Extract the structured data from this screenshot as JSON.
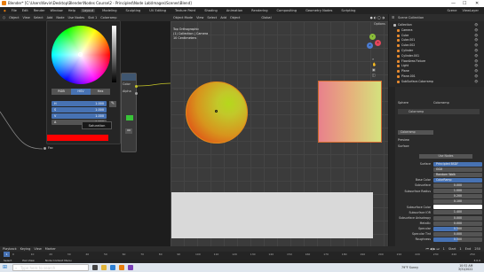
{
  "titlebar": {
    "title": "Blender* [C:\\Users\\Kevin\\Desktop\\Blender\\Nodes Course\\2 - Principled\\Node Lab\\Images\\Scenes\\Blend]",
    "min": "—",
    "max": "☐",
    "close": "✕"
  },
  "menubar": {
    "menus": [
      "File",
      "Edit",
      "Render",
      "Window",
      "Help"
    ],
    "workspaces": [
      "Layout",
      "Modeling",
      "Sculpting",
      "UV Editing",
      "Texture Paint",
      "Shading",
      "Animation",
      "Rendering",
      "Compositing",
      "Geometry Nodes",
      "Scripting"
    ],
    "active_workspace": "Layout",
    "scene": "Scene",
    "view_layer": "ViewLayer"
  },
  "node_editor": {
    "header": [
      "Object",
      "View",
      "Select",
      "Add",
      "Node",
      "Use Nodes",
      "Slot 1",
      "Colorramp"
    ],
    "socket_fac": "Fac",
    "socket_color": "Color",
    "socket_alpha": "Alpha"
  },
  "color_picker": {
    "tabs": [
      "RGB",
      "HSV",
      "Hex"
    ],
    "active_tab": "HSV",
    "fields": [
      {
        "label": "H",
        "value": "1.000"
      },
      {
        "label": "S",
        "value": "1.000"
      },
      {
        "label": "V",
        "value": "1.000"
      },
      {
        "label": "A",
        "value": "1.000"
      }
    ],
    "tooltip": "Saturation",
    "swatch_color": "#ff0000"
  },
  "viewport": {
    "header": [
      "Object Mode",
      "View",
      "Select",
      "Add",
      "Object",
      "Global"
    ],
    "overlay": [
      "Top Orthographic",
      "(1) Collection | Camera",
      "10 Centimeters"
    ],
    "options": "Options",
    "gizmo": {
      "x": "X",
      "y": "Y",
      "z": "Z"
    }
  },
  "outliner": {
    "header": "Scene Collection",
    "items": [
      "Collection",
      "Camera",
      "Cube",
      "Cube.001",
      "Cube.002",
      "Cylinder",
      "Cylinder.001",
      "FloorArea.Fixture",
      "Light",
      "Plane",
      "Plane.001",
      "SubSurface.Colorramp"
    ]
  },
  "properties": {
    "object": "Sphere",
    "material": "Colorramp",
    "slot": "Colorramp",
    "section": "Preview",
    "surface_label": "Surface",
    "use_nodes": "Use Nodes",
    "rows": [
      {
        "label": "Surface",
        "value": "Principled BSDF"
      },
      {
        "label": "",
        "value": "GGX"
      },
      {
        "label": "",
        "value": "Random Walk"
      },
      {
        "label": "Base Color",
        "value": "ColorRamp"
      },
      {
        "label": "Subsurface",
        "value": "0.000"
      },
      {
        "label": "Subsurface Radius",
        "value": "1.000"
      },
      {
        "label": "",
        "value": "0.200"
      },
      {
        "label": "",
        "value": "0.100"
      },
      {
        "label": "Subsurface Color",
        "value": ""
      },
      {
        "label": "Subsurface IOR",
        "value": "1.400"
      },
      {
        "label": "Subsurface Anisotropy",
        "value": "0.000"
      },
      {
        "label": "Metallic",
        "value": "0.000"
      },
      {
        "label": "Specular",
        "value": "0.500"
      },
      {
        "label": "Specular Tint",
        "value": "0.000"
      },
      {
        "label": "Roughness",
        "value": "0.500"
      }
    ]
  },
  "timeline": {
    "header": [
      "Playback",
      "Keying",
      "View",
      "Marker"
    ],
    "frame": "1",
    "start": "Start",
    "start_value": "1",
    "end": "End",
    "end_value": "250",
    "ticks": [
      "0",
      "10",
      "20",
      "30",
      "40",
      "50",
      "60",
      "70",
      "80",
      "90",
      "100",
      "110",
      "120",
      "130",
      "140",
      "150",
      "160",
      "170",
      "180",
      "190",
      "200",
      "210",
      "220",
      "230",
      "240",
      "250"
    ]
  },
  "statusbar": {
    "items": [
      "Select",
      "Pan View",
      "Node Context Menu"
    ],
    "version": "3.0.0"
  },
  "taskbar": {
    "search": "Type here to search",
    "weather": "79°F Sunny",
    "time": "10:52 AM",
    "date": "3/31/2022"
  }
}
